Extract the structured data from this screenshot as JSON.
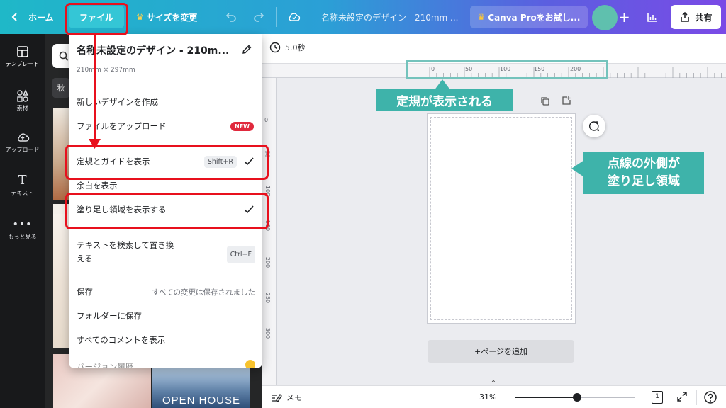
{
  "topbar": {
    "home_label": "ホーム",
    "file_label": "ファイル",
    "resize_label": "サイズを変更",
    "doc_title": "名称未設定のデザイン - 210mm ...",
    "pro_label": "Canva Proをお試し...",
    "share_label": "共有"
  },
  "sidebar": {
    "items": [
      {
        "label": "テンプレート",
        "icon": "layout-icon"
      },
      {
        "label": "素材",
        "icon": "shapes-icon"
      },
      {
        "label": "アップロード",
        "icon": "upload-cloud-icon"
      },
      {
        "label": "テキスト",
        "icon": "text-icon"
      },
      {
        "label": "もっと見る",
        "icon": "more-icon"
      }
    ]
  },
  "panel": {
    "chip_label": "秋",
    "open_house_text": "OPEN HOUSE"
  },
  "menu": {
    "title": "名称未設定のデザイン - 210m...",
    "size": "210mm × 297mm",
    "items": [
      {
        "label": "新しいデザインを作成"
      },
      {
        "label": "ファイルをアップロード",
        "badge": "NEW"
      },
      {
        "label": "定規とガイドを表示",
        "shortcut": "Shift+R",
        "checked": true
      },
      {
        "label": "余白を表示"
      },
      {
        "label": "塗り足し領域を表示する",
        "checked": true
      },
      {
        "label": "テキストを検索して置き換",
        "label2": "える",
        "shortcut": "Ctrl+F"
      },
      {
        "label": "保存",
        "note": "すべての変更は保存されました"
      },
      {
        "label": "フォルダーに保存"
      },
      {
        "label": "すべてのコメントを表示"
      },
      {
        "label": "バージョン履歴"
      }
    ]
  },
  "subbar": {
    "duration": "5.0秒"
  },
  "ruler": {
    "h_labels": [
      "0",
      "50",
      "100",
      "150",
      "200"
    ],
    "v_labels": [
      "0",
      "50",
      "100",
      "150",
      "200",
      "250",
      "300"
    ]
  },
  "canvas": {
    "add_page_label": "+ページを追加"
  },
  "bottombar": {
    "notes_label": "メモ",
    "zoom": "31%",
    "zoom_fraction": 0.31,
    "page_count": "1"
  },
  "annotations": {
    "ruler_note": "定規が表示される",
    "bleed_note_line1": "点線の外側が",
    "bleed_note_line2": "塗り足し領域"
  },
  "colors": {
    "accent_red": "#e8101d",
    "callout_teal": "#3eb3aa",
    "new_badge": "#e0293d"
  }
}
